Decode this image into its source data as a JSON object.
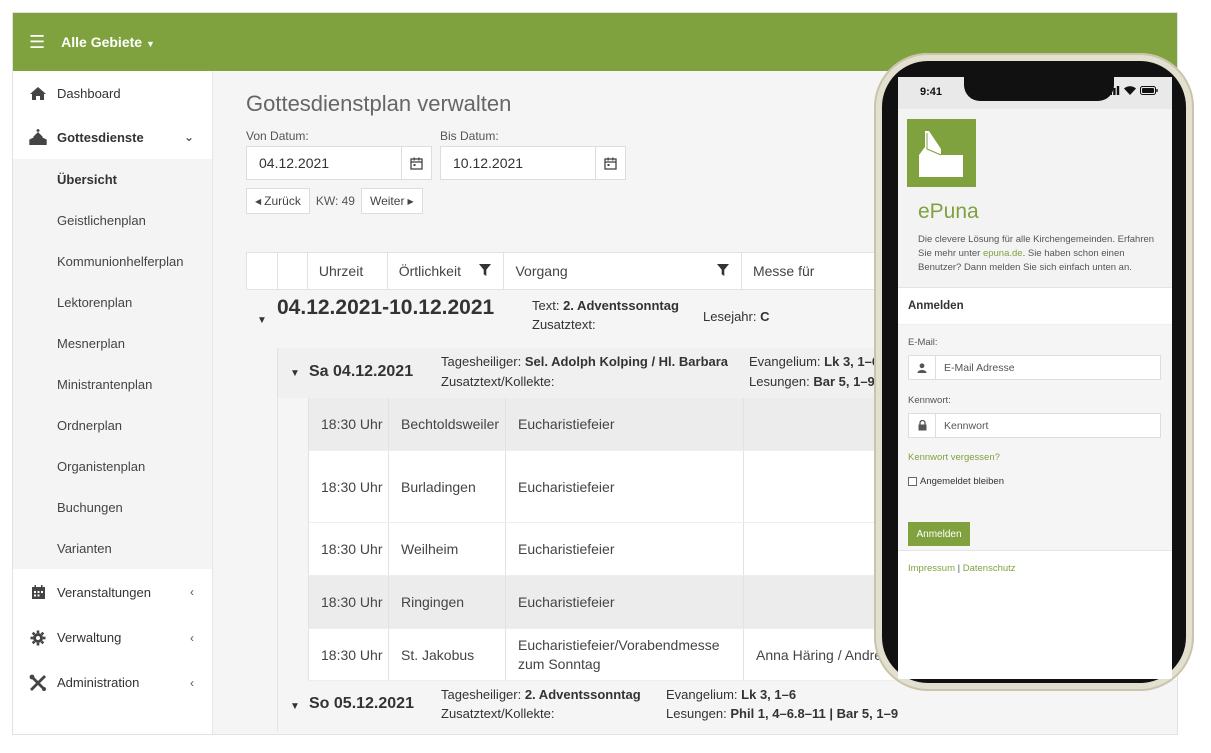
{
  "topbar": {
    "area_label": "Alle Gebiete"
  },
  "sidebar": {
    "dashboard": "Dashboard",
    "services": "Gottesdienste",
    "sub_items": [
      "Übersicht",
      "Geistlichenplan",
      "Kommunionhelferplan",
      "Lektorenplan",
      "Mesnerplan",
      "Ministrantenplan",
      "Ordnerplan",
      "Organistenplan",
      "Buchungen",
      "Varianten"
    ],
    "events": "Veranstaltungen",
    "management": "Verwaltung",
    "administration": "Administration"
  },
  "main": {
    "title": "Gottesdienstplan verwalten",
    "from_label": "Von Datum:",
    "from_value": "04.12.2021",
    "to_label": "Bis Datum:",
    "to_value": "10.12.2021",
    "back": "Zurück",
    "week": "KW: 49",
    "next": "Weiter"
  },
  "table": {
    "headers": [
      "Uhrzeit",
      "Örtlichkeit",
      "Vorgang",
      "Messe für"
    ],
    "week": {
      "range": "04.12.2021-10.12.2021",
      "text_label": "Text: ",
      "text_value": "2. Adventssonntag",
      "extra_label": "Zusatztext:",
      "year_label": "Lesejahr: ",
      "year_value": "C"
    },
    "day1": {
      "title": "Sa 04.12.2021",
      "saint_label": "Tagesheiliger: ",
      "saint_value": "Sel. Adolph Kolping / Hl. Barbara",
      "extra_label": "Zusatztext/Kollekte:",
      "gospel_label": "Evangelium: ",
      "gospel_value": "Lk 3, 1–6",
      "readings_label": "Lesungen: ",
      "readings_value": "Bar 5, 1–9"
    },
    "rows": [
      {
        "time": "18:30 Uhr",
        "place": "Bechtoldsweiler",
        "event": "Eucharistiefeier",
        "event2": "",
        "for": ""
      },
      {
        "time": "18:30 Uhr",
        "place": "Burladingen",
        "event": "Eucharistiefeier",
        "event2": "",
        "for": ""
      },
      {
        "time": "18:30 Uhr",
        "place": "Weilheim",
        "event": "Eucharistiefeier",
        "event2": "",
        "for": ""
      },
      {
        "time": "18:30 Uhr",
        "place": "Ringingen",
        "event": "Eucharistiefeier",
        "event2": "",
        "for": ""
      },
      {
        "time": "18:30 Uhr",
        "place": "St. Jakobus",
        "event": "Eucharistiefeier/Vorabendmesse",
        "event2": "zum Sonntag",
        "for": "Anna Häring / Andrea"
      }
    ],
    "day2": {
      "title": "So 05.12.2021",
      "saint_label": "Tagesheiliger: ",
      "saint_value": "2. Adventssonntag",
      "extra_label": "Zusatztext/Kollekte:",
      "gospel_label": "Evangelium: ",
      "gospel_value": "Lk 3, 1–6",
      "readings_label": "Lesungen: ",
      "readings_value": "Phil 1, 4–6.8–11 | Bar 5, 1–9"
    }
  },
  "phone": {
    "time": "9:41",
    "brand": "ePuna",
    "intro_1": "Die clevere Lösung für alle Kirchengemeinden. Erfahren Sie mehr unter ",
    "intro_link": "epuna.de",
    "intro_2": ". Sie haben schon einen Benutzer? Dann melden Sie sich einfach unten an.",
    "login_title": "Anmelden",
    "email_label": "E-Mail:",
    "email_placeholder": "E-Mail Adresse",
    "password_label": "Kennwort:",
    "password_placeholder": "Kennwort",
    "forgot": "Kennwort vergessen?",
    "remember": "Angemeldet bleiben",
    "submit": "Anmelden",
    "imprint": "Impressum",
    "separator": " | ",
    "privacy": "Datenschutz"
  },
  "colors": {
    "brand_green": "#7fa23f"
  }
}
